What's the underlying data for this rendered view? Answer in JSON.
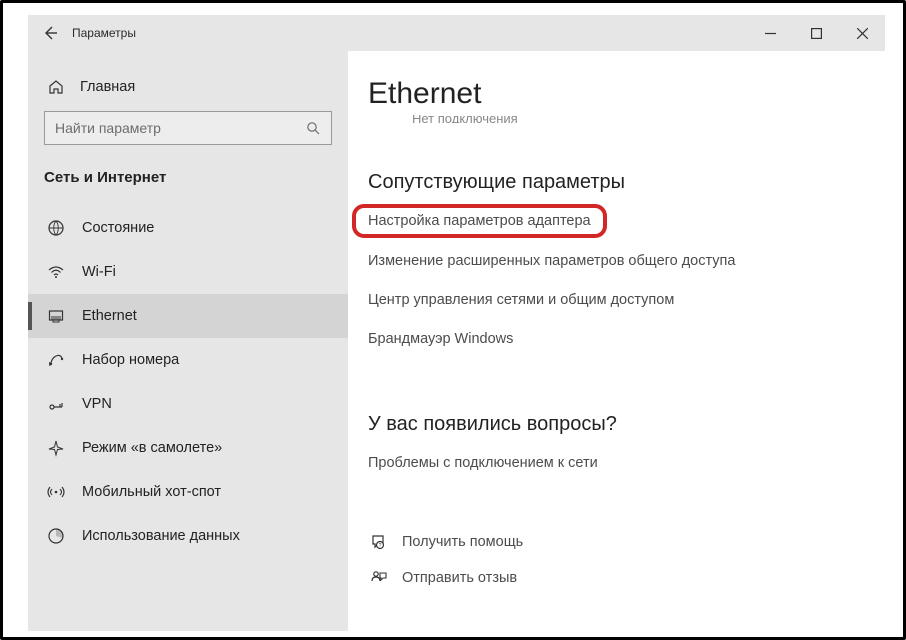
{
  "titlebar": {
    "title": "Параметры"
  },
  "sidebar": {
    "home_label": "Главная",
    "search_placeholder": "Найти параметр",
    "section_header": "Сеть и Интернет",
    "items": [
      {
        "label": "Состояние"
      },
      {
        "label": "Wi-Fi"
      },
      {
        "label": "Ethernet"
      },
      {
        "label": "Набор номера"
      },
      {
        "label": "VPN"
      },
      {
        "label": "Режим «в самолете»"
      },
      {
        "label": "Мобильный хот-спот"
      },
      {
        "label": "Использование данных"
      }
    ]
  },
  "main": {
    "page_title": "Ethernet",
    "clipped_text": "Нет подключения",
    "related_header": "Сопутствующие параметры",
    "links": [
      "Настройка параметров адаптера",
      "Изменение расширенных параметров общего доступа",
      "Центр управления сетями и общим доступом",
      "Брандмауэр Windows"
    ],
    "questions_header": "У вас появились вопросы?",
    "questions_link": "Проблемы с подключением к сети",
    "help": [
      "Получить помощь",
      "Отправить отзыв"
    ]
  }
}
